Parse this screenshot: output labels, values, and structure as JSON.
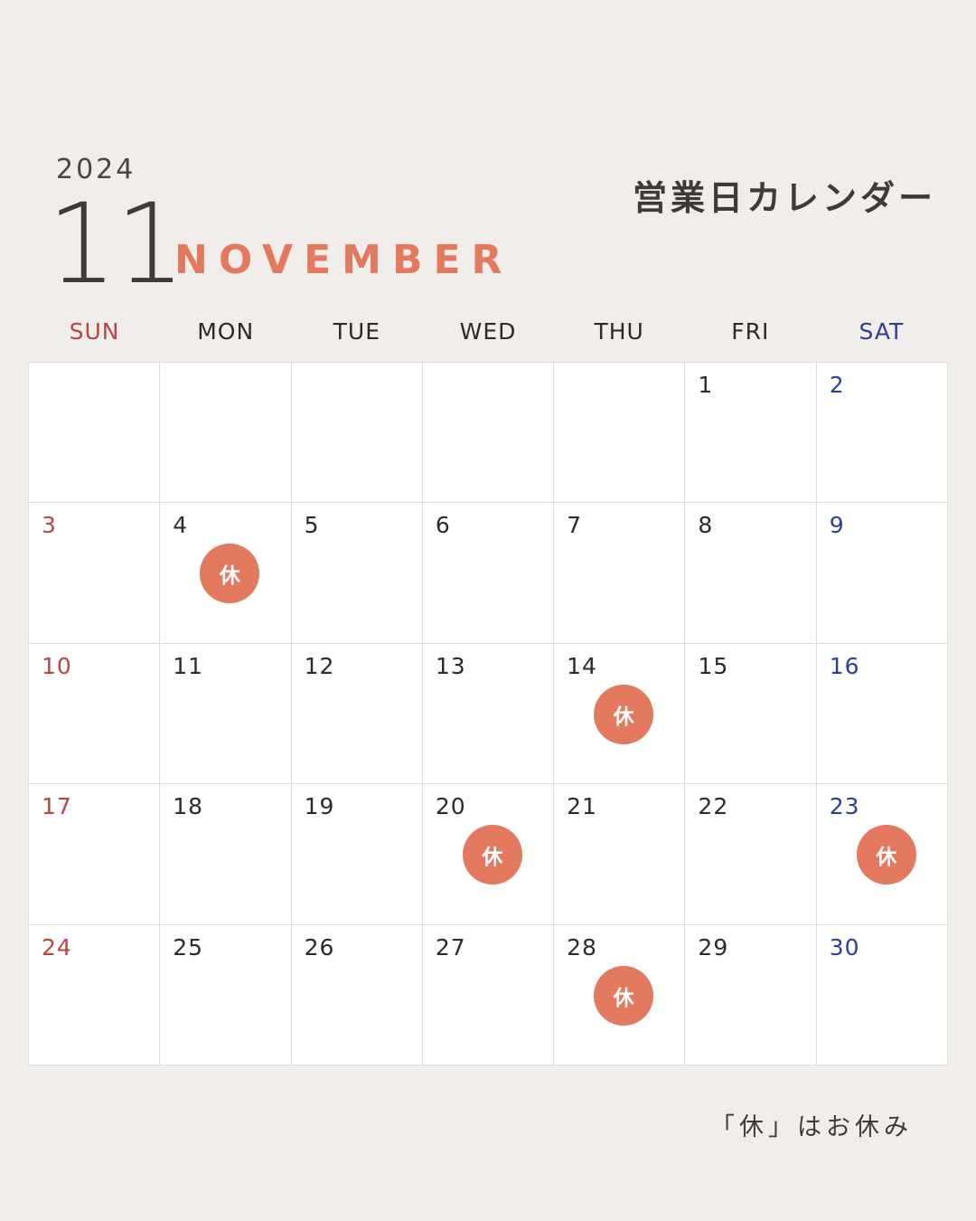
{
  "header": {
    "year": "2024",
    "month_number": "11",
    "month_name": "NOVEMBER",
    "title": "営業日カレンダー"
  },
  "weekdays": [
    "SUN",
    "MON",
    "TUE",
    "WED",
    "THU",
    "FRI",
    "SAT"
  ],
  "weeks": [
    [
      {
        "day": ""
      },
      {
        "day": ""
      },
      {
        "day": ""
      },
      {
        "day": ""
      },
      {
        "day": ""
      },
      {
        "day": "1"
      },
      {
        "day": "2"
      }
    ],
    [
      {
        "day": "3"
      },
      {
        "day": "4",
        "badge": "休"
      },
      {
        "day": "5"
      },
      {
        "day": "6"
      },
      {
        "day": "7"
      },
      {
        "day": "8"
      },
      {
        "day": "9"
      }
    ],
    [
      {
        "day": "10"
      },
      {
        "day": "11"
      },
      {
        "day": "12"
      },
      {
        "day": "13"
      },
      {
        "day": "14",
        "badge": "休"
      },
      {
        "day": "15"
      },
      {
        "day": "16"
      }
    ],
    [
      {
        "day": "17"
      },
      {
        "day": "18"
      },
      {
        "day": "19"
      },
      {
        "day": "20",
        "badge": "休"
      },
      {
        "day": "21"
      },
      {
        "day": "22"
      },
      {
        "day": "23",
        "badge": "休"
      }
    ],
    [
      {
        "day": "24"
      },
      {
        "day": "25"
      },
      {
        "day": "26"
      },
      {
        "day": "27"
      },
      {
        "day": "28",
        "badge": "休"
      },
      {
        "day": "29"
      },
      {
        "day": "30"
      }
    ]
  ],
  "footnote": "「休」はお休み",
  "colors": {
    "background": "#f1edea",
    "accent": "#e37a60",
    "sunday": "#b8453f",
    "saturday": "#2d3f93"
  }
}
